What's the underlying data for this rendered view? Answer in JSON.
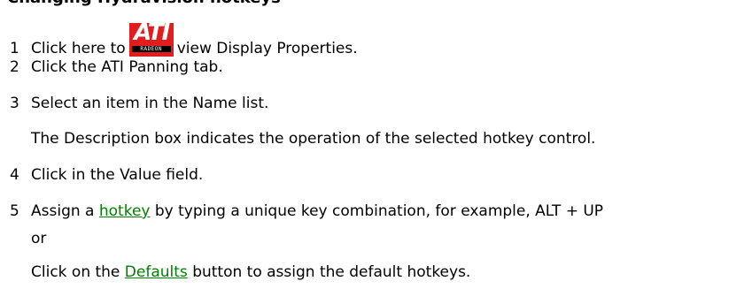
{
  "heading": "Changing Hydravision hotkeys",
  "steps": [
    {
      "number": "1",
      "before": "Click here to",
      "after": "view Display Properties."
    },
    {
      "number": "2",
      "text": "Click the ATI Panning tab."
    },
    {
      "number": "3",
      "text": "Select an item in the Name list.",
      "continuation": "The Description box indicates the operation of the selected hotkey control."
    },
    {
      "number": "4",
      "text": "Click in the Value field."
    },
    {
      "number": "5",
      "before": "Assign a",
      "link": "hotkey",
      "after": "by typing a unique key combination, for example, ALT + UP",
      "or": "or",
      "alt_before": "Click on the",
      "alt_link": "Defaults",
      "alt_after": "button to assign the default hotkeys."
    }
  ],
  "logo": {
    "letters": "ATI",
    "strip_text": "RADEON",
    "icon": "ati-display-properties-icon",
    "background_color": "#e21d1d"
  },
  "colors": {
    "link": "#008000",
    "text": "#000000"
  }
}
